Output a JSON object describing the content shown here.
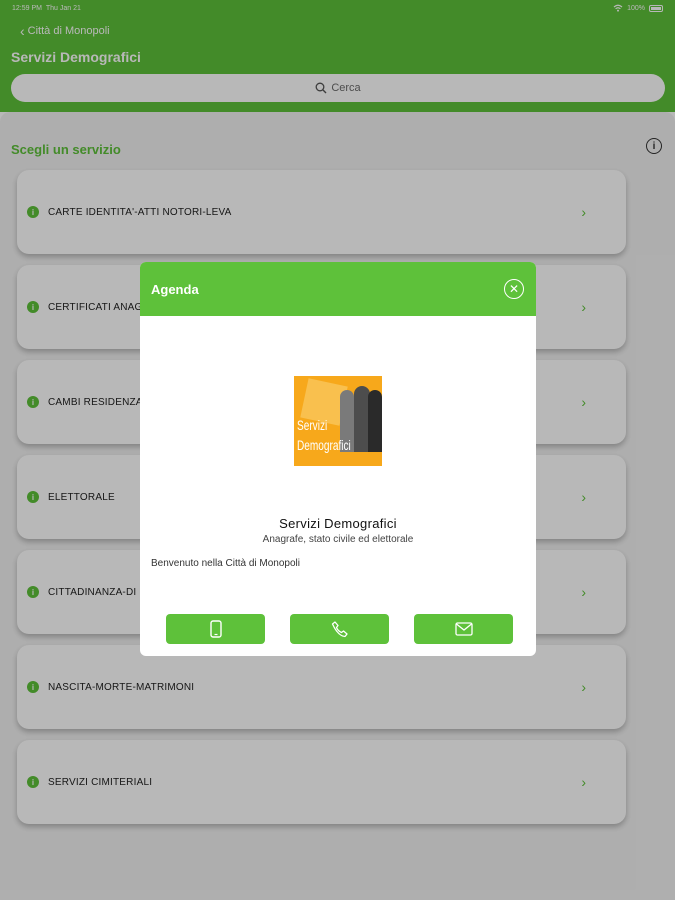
{
  "status_bar": {
    "time": "12:59 PM",
    "date": "Thu Jan 21",
    "battery": "100%"
  },
  "header": {
    "back_label": "Città di Monopoli",
    "title": "Servizi Demografici",
    "search_placeholder": "Cerca"
  },
  "main": {
    "section_title": "Scegli un servizio",
    "services": [
      {
        "label": "CARTE IDENTITA'-ATTI NOTORI-LEVA"
      },
      {
        "label": "CERTIFICATI ANAGRAFICI"
      },
      {
        "label": "CAMBI RESIDENZA"
      },
      {
        "label": "ELETTORALE"
      },
      {
        "label": "CITTADINANZA-DI"
      },
      {
        "label": "NASCITA-MORTE-MATRIMONI"
      },
      {
        "label": "SERVIZI CIMITERIALI"
      }
    ]
  },
  "modal": {
    "title": "Agenda",
    "logo_text_line1": "Servizi",
    "logo_text_line2": "Demografici",
    "entity_name": "Servizi Demografici",
    "entity_description": "Anagrafe, stato civile ed elettorale",
    "welcome_text": "Benvenuto nella Città di Monopoli",
    "actions": [
      {
        "icon": "mobile-phone-icon"
      },
      {
        "icon": "phone-icon"
      },
      {
        "icon": "mail-icon"
      }
    ]
  },
  "colors": {
    "accent": "#5ec13a",
    "logo_orange": "#f7a81b"
  }
}
